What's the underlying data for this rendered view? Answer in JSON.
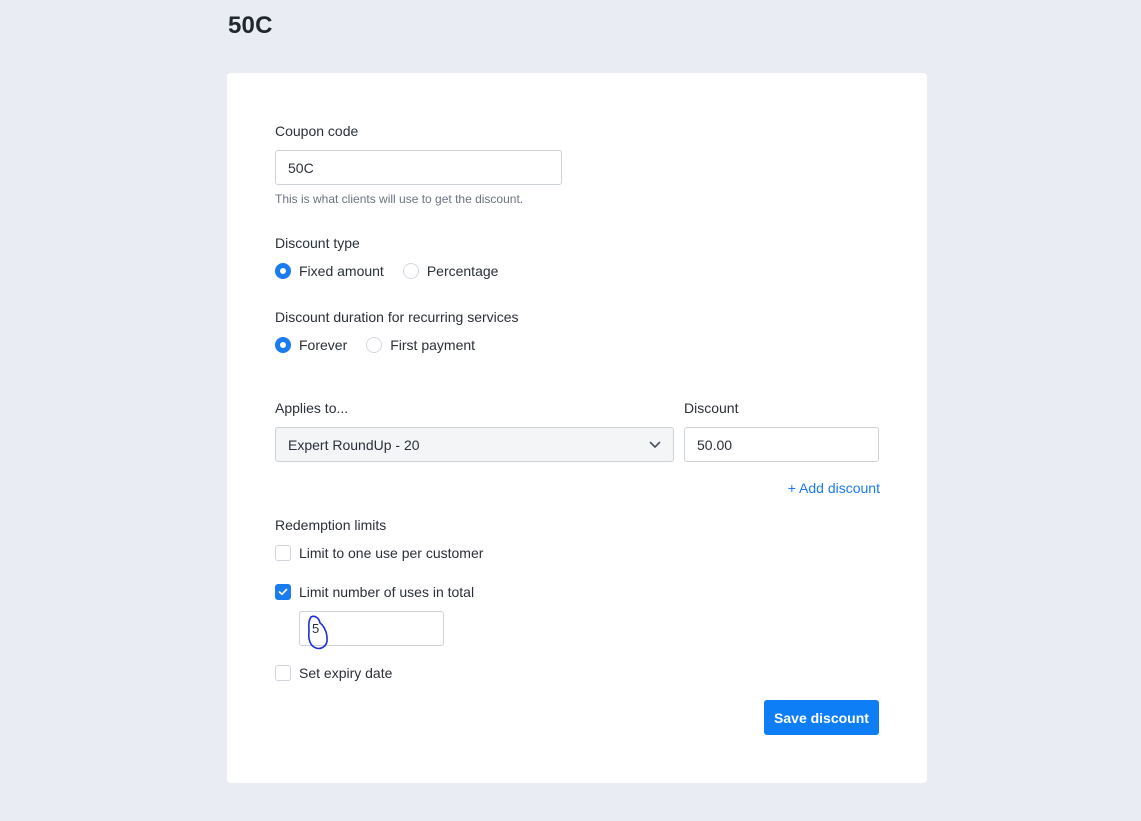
{
  "page": {
    "title": "50C"
  },
  "coupon": {
    "label": "Coupon code",
    "value": "50C",
    "help": "This is what clients will use to get the discount."
  },
  "discount_type": {
    "label": "Discount type",
    "options": [
      {
        "label": "Fixed amount",
        "selected": true
      },
      {
        "label": "Percentage",
        "selected": false
      }
    ]
  },
  "duration": {
    "label": "Discount duration for recurring services",
    "options": [
      {
        "label": "Forever",
        "selected": true
      },
      {
        "label": "First payment",
        "selected": false
      }
    ]
  },
  "applies": {
    "label": "Applies to...",
    "selected": "Expert RoundUp - 20",
    "discount_label": "Discount",
    "discount_value": "50.00",
    "add_label": "+ Add discount"
  },
  "limits": {
    "label": "Redemption limits",
    "one_per_customer": {
      "label": "Limit to one use per customer",
      "checked": false
    },
    "total_uses": {
      "label": "Limit number of uses in total",
      "checked": true,
      "value": "5"
    },
    "expiry": {
      "label": "Set expiry date",
      "checked": false
    }
  },
  "actions": {
    "save_label": "Save discount"
  },
  "colors": {
    "accent": "#0d7ef5",
    "background": "#e9ecf3",
    "annotation": "#1f2bd6"
  }
}
